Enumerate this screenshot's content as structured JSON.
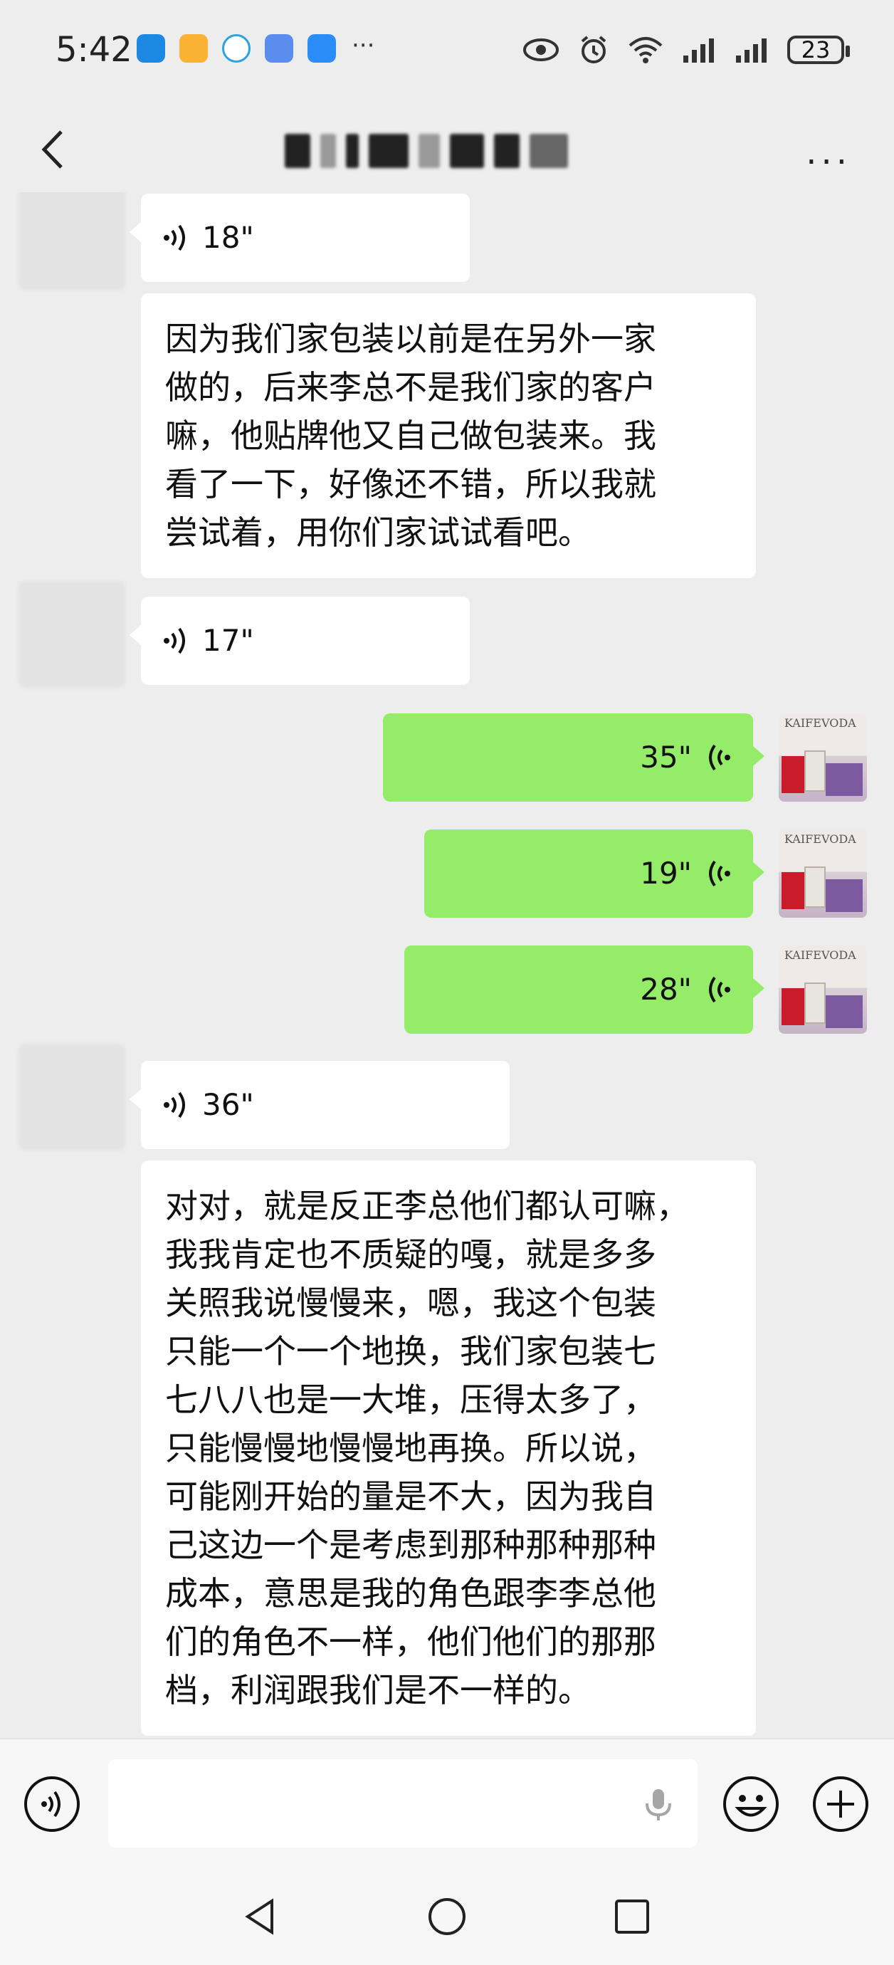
{
  "status_bar": {
    "time": "5:42",
    "battery": "23",
    "more_indicator": "···"
  },
  "header": {
    "more_label": "···"
  },
  "messages": [
    {
      "side": "in",
      "type": "voice",
      "duration": "18\""
    },
    {
      "side": "in",
      "type": "text",
      "lines": [
        "因为我们家包装以前是在另外一家",
        "做的，后来李总不是我们家的客户",
        "嘛，他贴牌他又自己做包装来。我",
        "看了一下，好像还不错，所以我就",
        "尝试着，用你们家试试看吧。"
      ]
    },
    {
      "side": "in",
      "type": "voice",
      "duration": "17\""
    },
    {
      "side": "out",
      "type": "voice",
      "duration": "35\""
    },
    {
      "side": "out",
      "type": "voice",
      "duration": "19\""
    },
    {
      "side": "out",
      "type": "voice",
      "duration": "28\""
    },
    {
      "side": "in",
      "type": "voice",
      "duration": "36\""
    },
    {
      "side": "in",
      "type": "text",
      "lines": [
        "对对，就是反正李总他们都认可嘛，",
        "我我肯定也不质疑的嘎，就是多多",
        "关照我说慢慢来，嗯，我这个包装",
        "只能一个一个地换，我们家包装七",
        "七八八也是一大堆，压得太多了，",
        "只能慢慢地慢慢地再换。所以说，",
        "可能刚开始的量是不大，因为我自",
        "己这边一个是考虑到那种那种那种",
        "成本，意思是我的角色跟李李总他",
        "们的角色不一样，他们他们的那那",
        "档，利润跟我们是不一样的。"
      ]
    }
  ],
  "avatar_right": {
    "brand": "KAIFEVODA"
  },
  "colors": {
    "background": "#ededed",
    "out_bubble": "#95ec69",
    "in_bubble": "#ffffff"
  },
  "icons": [
    "back-icon",
    "more-icon",
    "voice-mode-icon",
    "mic-icon",
    "emoji-icon",
    "plus-icon",
    "nav-back-icon",
    "nav-home-icon",
    "nav-recent-icon"
  ]
}
